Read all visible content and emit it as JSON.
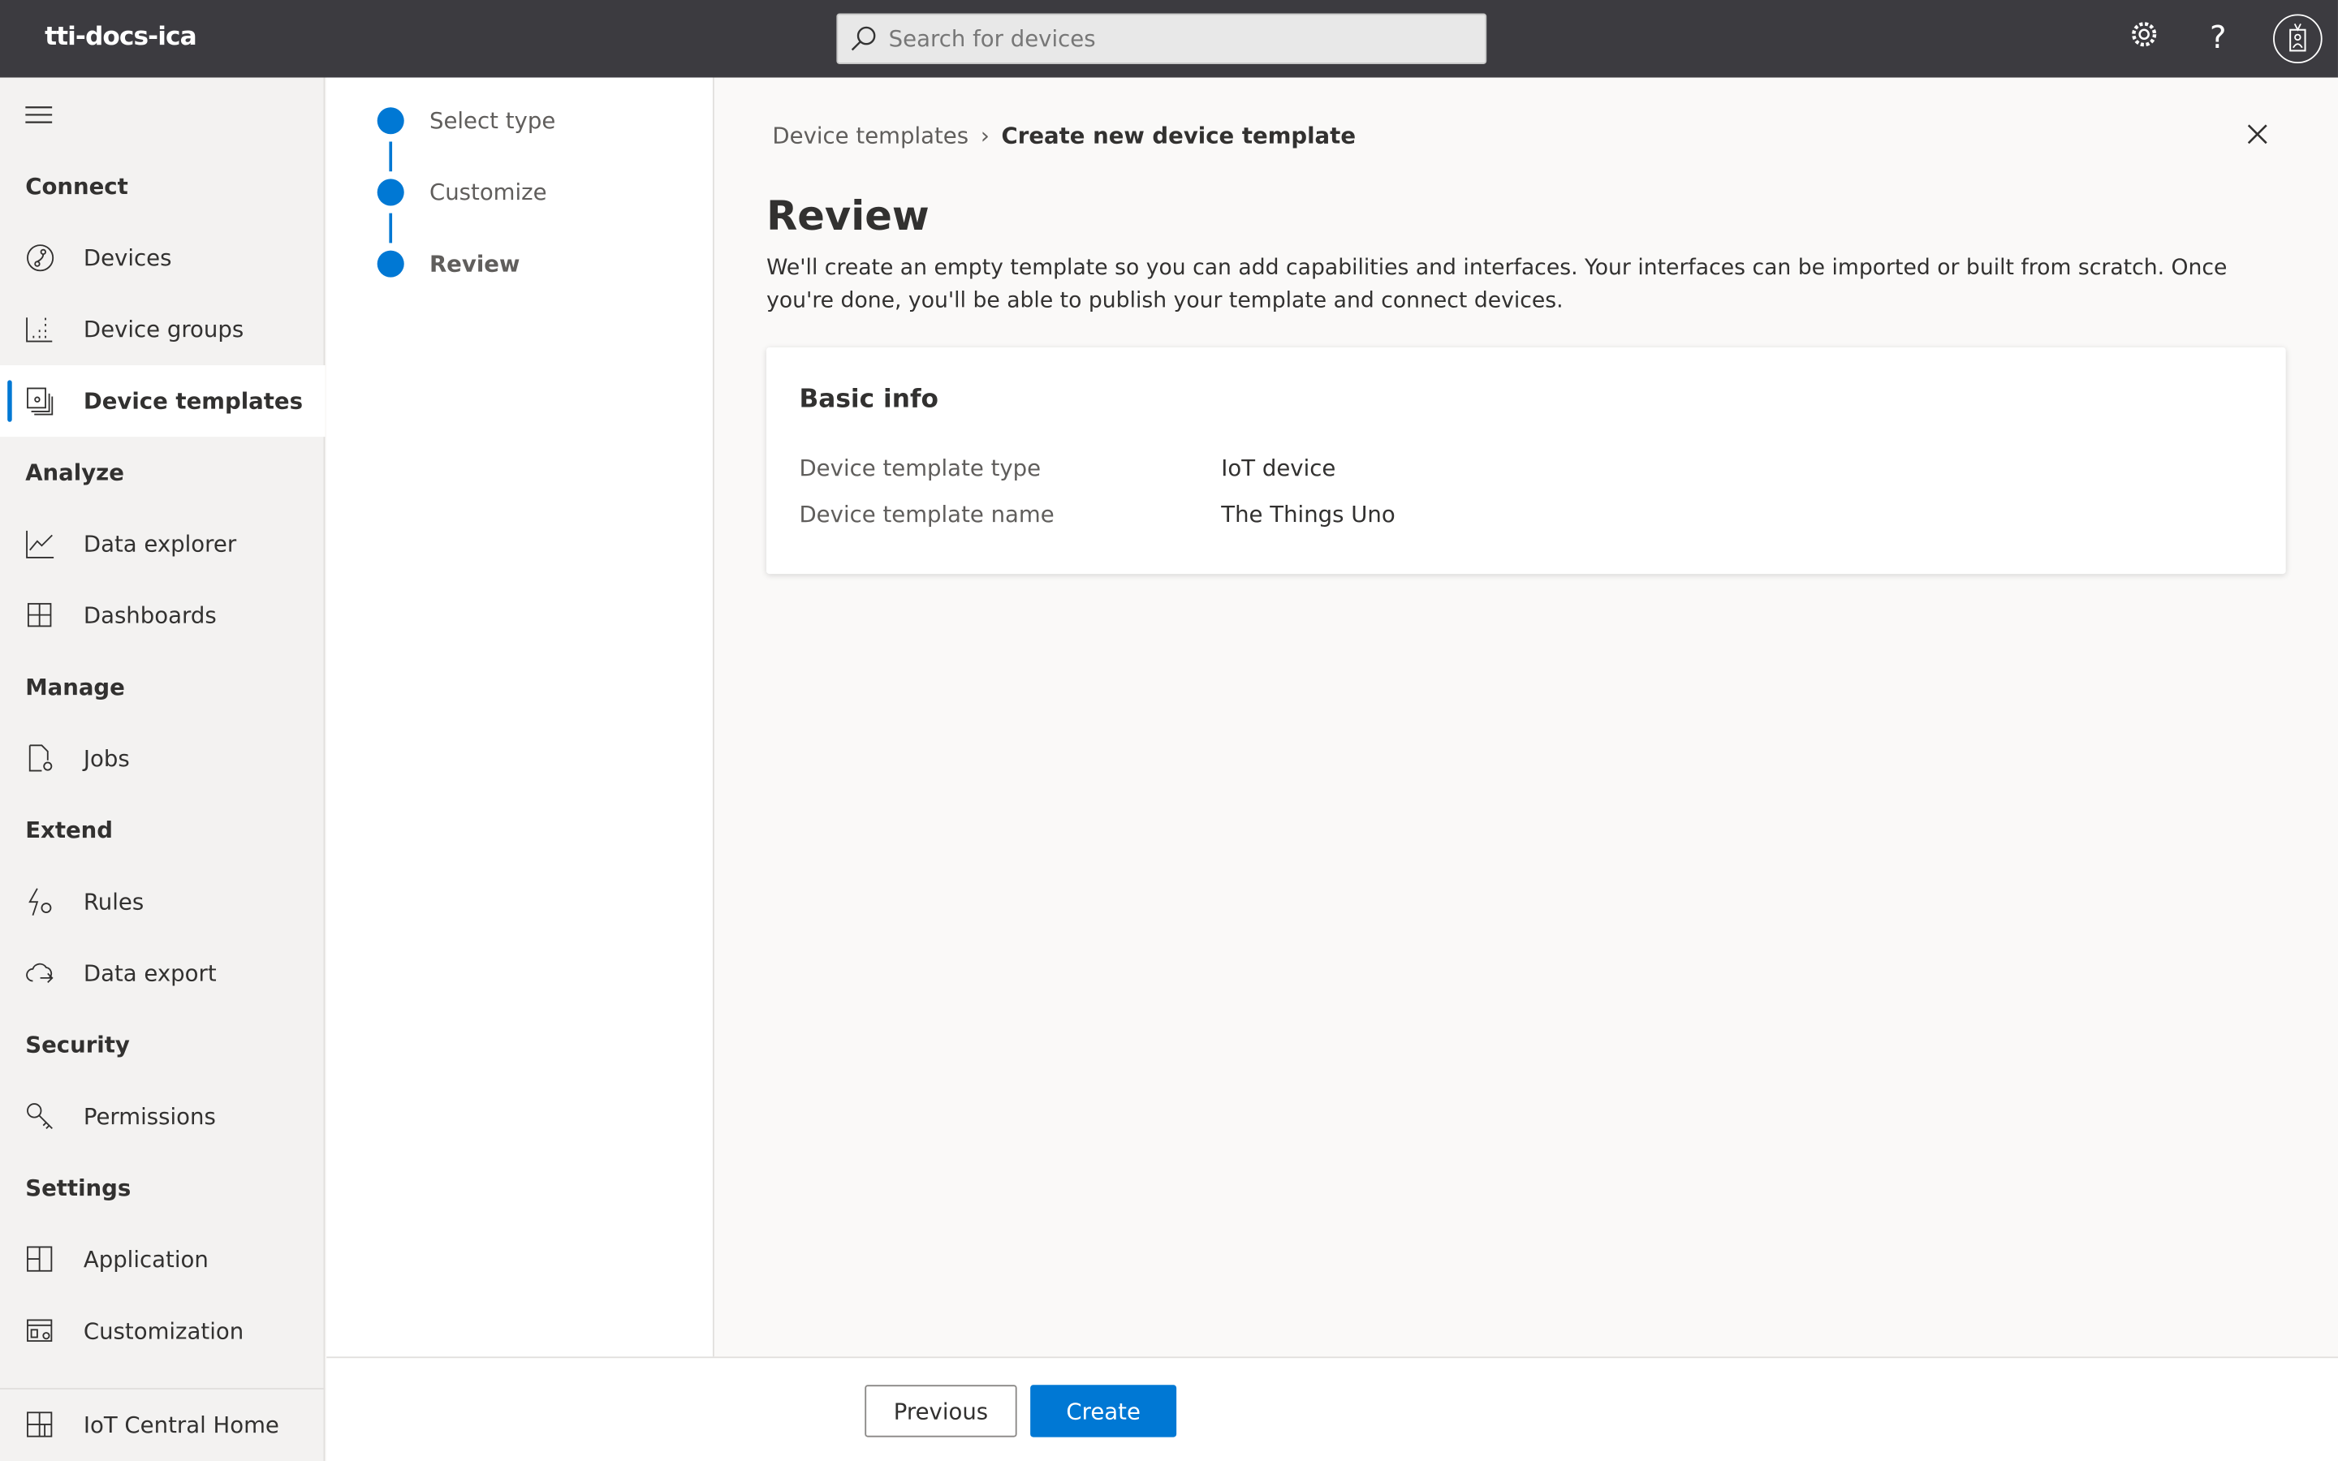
{
  "header": {
    "app_name": "tti-docs-ica",
    "search_placeholder": "Search for devices"
  },
  "sidebar": {
    "sections": [
      {
        "title": "Connect",
        "items": [
          "Devices",
          "Device groups",
          "Device templates"
        ]
      },
      {
        "title": "Analyze",
        "items": [
          "Data explorer",
          "Dashboards"
        ]
      },
      {
        "title": "Manage",
        "items": [
          "Jobs"
        ]
      },
      {
        "title": "Extend",
        "items": [
          "Rules",
          "Data export"
        ]
      },
      {
        "title": "Security",
        "items": [
          "Permissions"
        ]
      },
      {
        "title": "Settings",
        "items": [
          "Application",
          "Customization"
        ]
      }
    ],
    "active": "Device templates",
    "home": "IoT Central Home"
  },
  "steps": [
    "Select type",
    "Customize",
    "Review"
  ],
  "breadcrumb": {
    "parent": "Device templates",
    "current": "Create new device template"
  },
  "main": {
    "title": "Review",
    "description": "We'll create an empty template so you can add capabilities and interfaces. Your interfaces can be imported or built from scratch. Once you're done, you'll be able to publish your template and connect devices.",
    "card": {
      "title": "Basic info",
      "rows": [
        {
          "label": "Device template type",
          "value": "IoT device"
        },
        {
          "label": "Device template name",
          "value": "The Things Uno"
        }
      ]
    }
  },
  "footer": {
    "previous": "Previous",
    "create": "Create"
  },
  "colors": {
    "accent": "#0078d4",
    "topbar": "#3c3b40"
  }
}
